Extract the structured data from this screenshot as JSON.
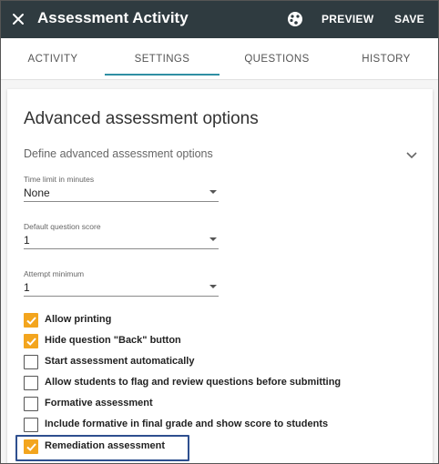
{
  "header": {
    "title": "Assessment Activity",
    "preview_label": "PREVIEW",
    "save_label": "SAVE"
  },
  "tabs": [
    {
      "label": "ACTIVITY"
    },
    {
      "label": "SETTINGS"
    },
    {
      "label": "QUESTIONS"
    },
    {
      "label": "HISTORY"
    }
  ],
  "active_tab": "SETTINGS",
  "card": {
    "title": "Advanced assessment options",
    "subtitle": "Define advanced assessment options"
  },
  "fields": [
    {
      "label": "Time limit in minutes",
      "value": "None"
    },
    {
      "label": "Default question score",
      "value": "1"
    },
    {
      "label": "Attempt minimum",
      "value": "1"
    }
  ],
  "checkboxes": [
    {
      "label": "Allow printing",
      "checked": true
    },
    {
      "label": "Hide question \"Back\" button",
      "checked": true
    },
    {
      "label": "Start assessment automatically",
      "checked": false
    },
    {
      "label": "Allow students to flag and review questions before submitting",
      "checked": false
    },
    {
      "label": "Formative assessment",
      "checked": false
    },
    {
      "label": "Include formative in final grade and show score to students",
      "checked": false
    },
    {
      "label": "Remediation assessment",
      "checked": true
    }
  ],
  "colors": {
    "header_bg": "#2f3b40",
    "accent_checkbox": "#f3a51e",
    "tab_underline": "#2f8fa3",
    "highlight_border": "#2e4f8f"
  }
}
